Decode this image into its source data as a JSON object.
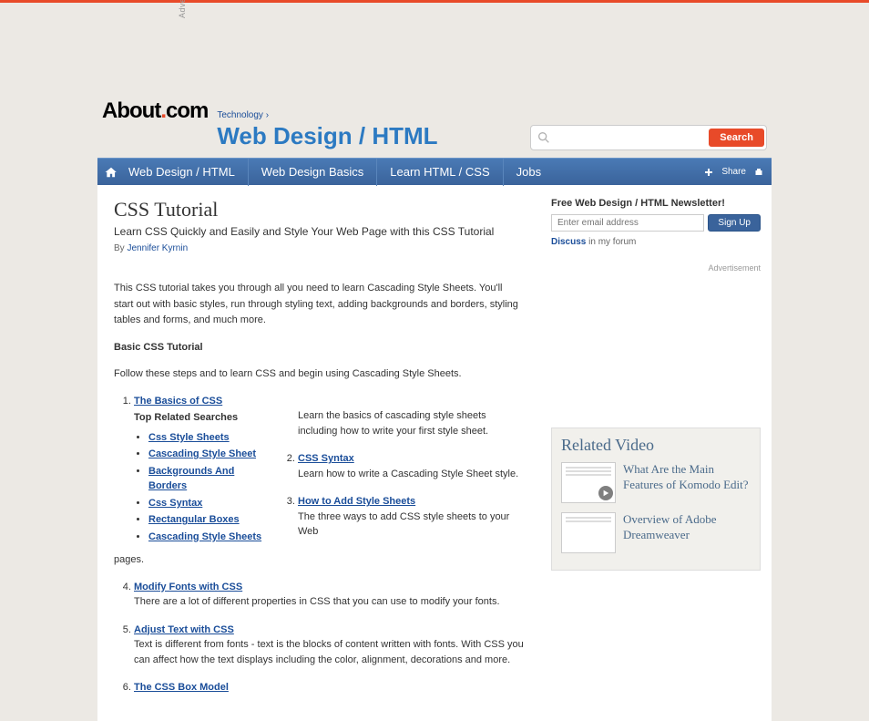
{
  "ad_label_vertical": "Advertisement",
  "breadcrumb": "Technology ›",
  "logo": {
    "text1": "About",
    "dot": ".",
    "text2": "com"
  },
  "site_title": "Web Design / HTML",
  "search": {
    "placeholder": "",
    "button": "Search"
  },
  "nav": {
    "items": [
      "Web Design / HTML",
      "Web Design Basics",
      "Learn HTML / CSS",
      "Jobs"
    ],
    "share": "Share"
  },
  "article": {
    "title": "CSS Tutorial",
    "subtitle": "Learn CSS Quickly and Easily and Style Your Web Page with this CSS Tutorial",
    "byline_prefix": "By ",
    "author": "Jennifer Kyrnin",
    "intro": "This CSS tutorial takes you through all you need to learn Cascading Style Sheets. You'll start out with basic styles, run through styling text, adding backgrounds and borders, styling tables and forms, and much more.",
    "section_heading": "Basic CSS Tutorial",
    "follow_text": "Follow these steps and to learn CSS and begin using Cascading Style Sheets.",
    "items": [
      {
        "link": "The Basics of CSS",
        "desc": "Learn the basics of cascading style sheets including how to write your first style sheet.",
        "offset": true
      },
      {
        "link": "CSS Syntax",
        "desc": "Learn how to write a Cascading Style Sheet style.",
        "offset": true
      },
      {
        "link": "How to Add Style Sheets",
        "desc": "The three ways to add CSS style sheets to your Web",
        "offset": true
      },
      {
        "link": "Modify Fonts with CSS",
        "desc": "There are a lot of different properties in CSS that you can use to modify your fonts.",
        "offset": false
      },
      {
        "link": "Adjust Text with CSS",
        "desc": "Text is different from fonts - text is the blocks of content written with fonts. With CSS you can affect how the text displays including the color, alignment, decorations and more.",
        "offset": false
      },
      {
        "link": "The CSS Box Model",
        "desc": "",
        "offset": false
      }
    ],
    "pages_word": "pages."
  },
  "related_searches": {
    "heading": "Top Related Searches",
    "links": [
      "Css Style Sheets",
      "Cascading Style Sheet",
      "Backgrounds And Borders",
      "Css Syntax",
      "Rectangular Boxes",
      "Cascading Style Sheets"
    ]
  },
  "newsletter": {
    "title": "Free Web Design / HTML Newsletter!",
    "placeholder": "Enter email address",
    "button": "Sign Up",
    "discuss_link": "Discuss",
    "discuss_suffix": " in my forum"
  },
  "right_ad_label": "Advertisement",
  "related_video": {
    "heading": "Related Video",
    "items": [
      "What Are the Main Features of Komodo Edit?",
      "Overview of Adobe Dreamweaver"
    ]
  }
}
